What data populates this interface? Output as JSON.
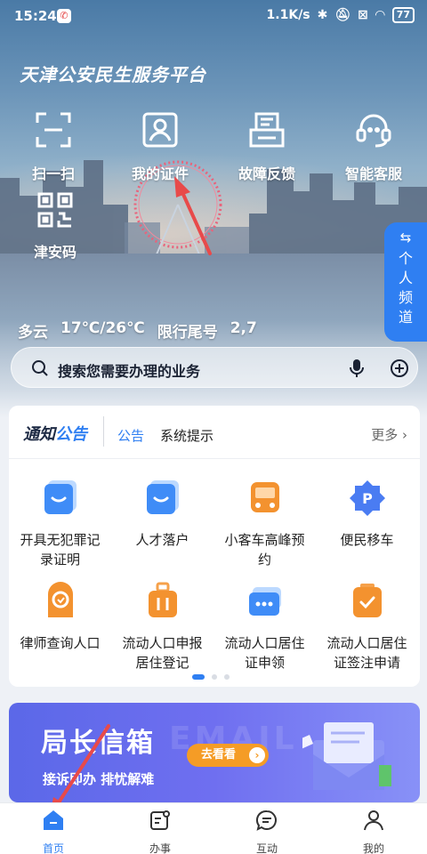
{
  "status_bar": {
    "time": "15:24",
    "network_speed": "1.1K/s",
    "battery": "77"
  },
  "header": {
    "title": "天津公安民生服务平台"
  },
  "quick_actions": [
    {
      "label": "扫一扫",
      "icon": "scan-icon"
    },
    {
      "label": "我的证件",
      "icon": "id-card-icon"
    },
    {
      "label": "故障反馈",
      "icon": "feedback-icon"
    },
    {
      "label": "智能客服",
      "icon": "headset-icon"
    }
  ],
  "jinan_code": {
    "label": "津安码",
    "icon": "qr-code-icon"
  },
  "weather": {
    "condition": "多云",
    "temperature": "17℃/26℃",
    "restriction_label": "限行尾号",
    "restriction_numbers": "2,7"
  },
  "personal_channel": {
    "label": "个人频道"
  },
  "search": {
    "placeholder": "搜索您需要办理的业务"
  },
  "notice": {
    "logo_part1": "通知",
    "logo_part2": "公告",
    "tab_announcement": "公告",
    "tab_system": "系统提示",
    "more": "更多"
  },
  "services": [
    {
      "line1": "开具无犯罪记",
      "line2": "录证明",
      "icon": "certificate-icon"
    },
    {
      "line1": "人才落户",
      "line2": "",
      "icon": "talent-icon"
    },
    {
      "line1": "小客车高峰预",
      "line2": "约",
      "icon": "bus-icon"
    },
    {
      "line1": "便民移车",
      "line2": "",
      "icon": "parking-icon"
    },
    {
      "line1": "律师查询人口",
      "line2": "",
      "icon": "lawyer-icon"
    },
    {
      "line1": "流动人口申报",
      "line2": "居住登记",
      "icon": "suitcase-icon"
    },
    {
      "line1": "流动人口居住",
      "line2": "证申领",
      "icon": "card-icon"
    },
    {
      "line1": "流动人口居住",
      "line2": "证签注申请",
      "icon": "clipboard-icon"
    }
  ],
  "banner": {
    "title": "局长信箱",
    "subtitle": "接诉即办 排忧解难",
    "button": "去看看",
    "watermark": "EMAIL"
  },
  "tabbar": [
    {
      "label": "首页",
      "icon": "home-icon",
      "active": true
    },
    {
      "label": "办事",
      "icon": "tasks-icon",
      "active": false
    },
    {
      "label": "互动",
      "icon": "chat-icon",
      "active": false
    },
    {
      "label": "我的",
      "icon": "user-icon",
      "active": false
    }
  ],
  "colors": {
    "accent": "#2f7ff2",
    "banner": "#6f6ff0",
    "annotation_arrow": "#e84a4a"
  }
}
